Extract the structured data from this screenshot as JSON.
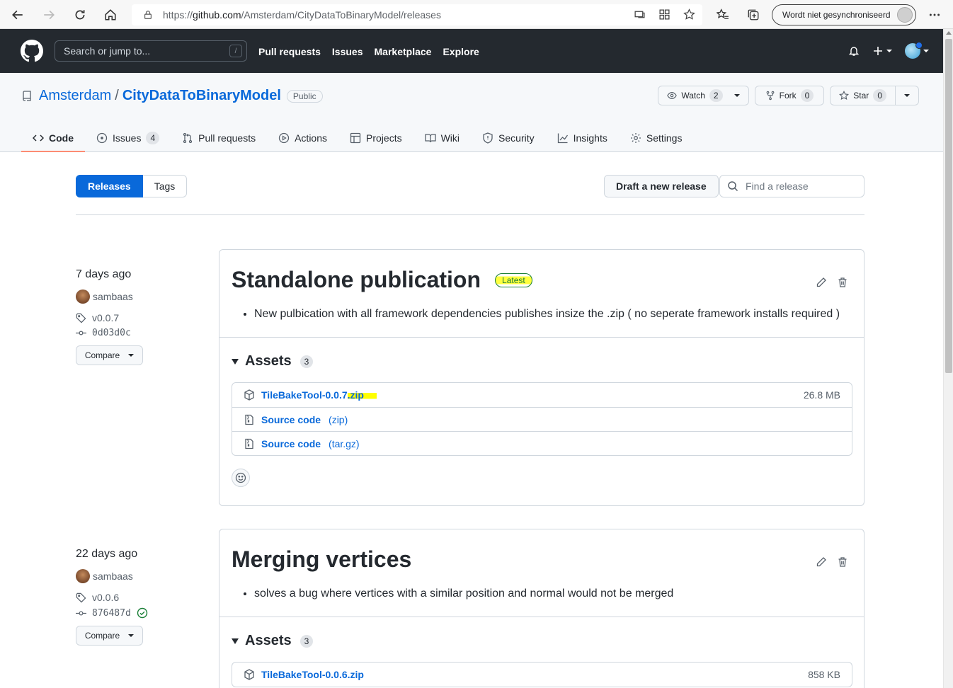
{
  "browser": {
    "url_prefix": "https://",
    "url_host": "github.com",
    "url_path": "/Amsterdam/CityDataToBinaryModel/releases",
    "profile_label": "Wordt niet gesynchroniseerd"
  },
  "header": {
    "search_placeholder": "Search or jump to...",
    "search_shortcut": "/",
    "nav": [
      "Pull requests",
      "Issues",
      "Marketplace",
      "Explore"
    ]
  },
  "repo": {
    "owner": "Amsterdam",
    "separator": "/",
    "name": "CityDataToBinaryModel",
    "visibility": "Public",
    "watch_label": "Watch",
    "watch_count": "2",
    "fork_label": "Fork",
    "fork_count": "0",
    "star_label": "Star",
    "star_count": "0"
  },
  "tabs": [
    {
      "label": "Code",
      "icon": "code-icon"
    },
    {
      "label": "Issues",
      "count": "4",
      "icon": "issue-icon"
    },
    {
      "label": "Pull requests",
      "icon": "pull-request-icon"
    },
    {
      "label": "Actions",
      "icon": "play-icon"
    },
    {
      "label": "Projects",
      "icon": "table-icon"
    },
    {
      "label": "Wiki",
      "icon": "book-icon"
    },
    {
      "label": "Security",
      "icon": "shield-icon"
    },
    {
      "label": "Insights",
      "icon": "graph-icon"
    },
    {
      "label": "Settings",
      "icon": "gear-icon"
    }
  ],
  "releases_bar": {
    "releases": "Releases",
    "tags": "Tags",
    "draft": "Draft a new release",
    "find_placeholder": "Find a release"
  },
  "releases": [
    {
      "when": "7 days ago",
      "author": "sambaas",
      "tag": "v0.0.7",
      "commit": "0d03d0c",
      "compare": "Compare",
      "title": "Standalone publication",
      "badge": "Latest",
      "notes": [
        "New pulbication with all framework dependencies publishes insize the .zip ( no seperate framework installs required )"
      ],
      "assets_label": "Assets",
      "assets_count": "3",
      "assets": [
        {
          "name": "TileBakeTool-0.0.7",
          "ext": ".zip",
          "size": "26.8 MB"
        },
        {
          "name": "Source code",
          "ext": "(zip)"
        },
        {
          "name": "Source code",
          "ext": "(tar.gz)"
        }
      ]
    },
    {
      "when": "22 days ago",
      "author": "sambaas",
      "tag": "v0.0.6",
      "commit": "876487d",
      "compare": "Compare",
      "title": "Merging vertices",
      "notes": [
        "solves a bug where vertices with a similar position and normal would not be merged"
      ],
      "assets_label": "Assets",
      "assets_count": "3",
      "assets": [
        {
          "name": "TileBakeTool-0.0.6.zip",
          "size": "858 KB"
        }
      ]
    }
  ],
  "colors": {
    "header_bg": "#24292f",
    "link": "#0969da",
    "accent_tab": "#fd8c73",
    "latest": "#1a7f37",
    "highlight": "#ffff00"
  }
}
